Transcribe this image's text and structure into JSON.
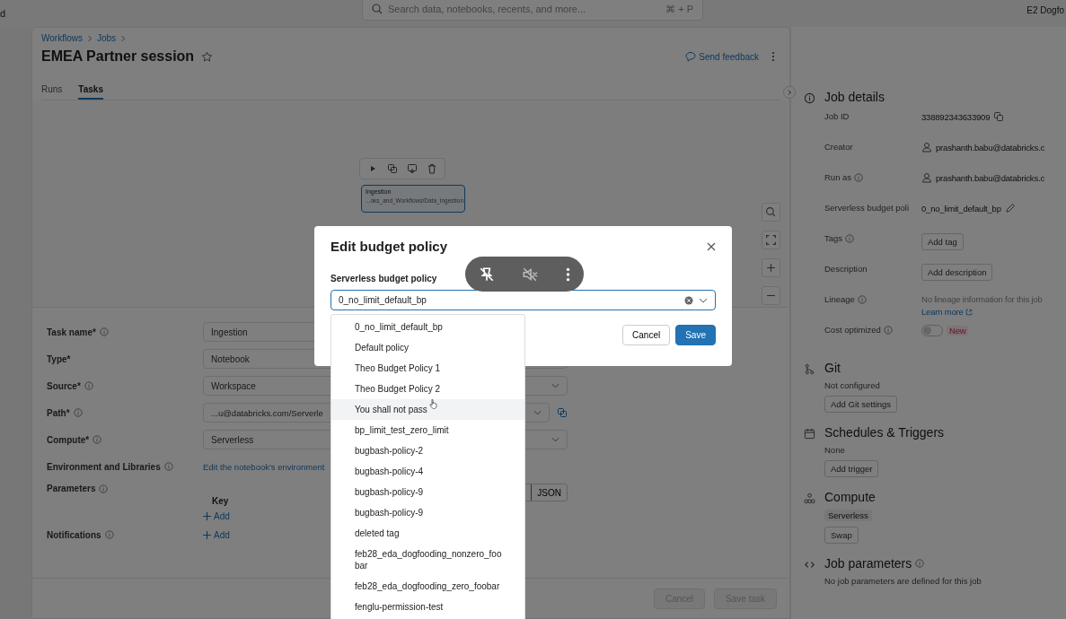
{
  "top_bar": {
    "left_text": "d",
    "search": {
      "placeholder": "Search data, notebooks, recents, and more...",
      "shortcut": "⌘ + P"
    },
    "workspace": "E2 Dogfo"
  },
  "breadcrumbs": [
    "Workflows",
    "Jobs"
  ],
  "job_title": "EMEA Partner session",
  "feedback": "Send feedback",
  "tabs": [
    {
      "label": "Runs",
      "selected": false
    },
    {
      "label": "Tasks",
      "selected": true
    }
  ],
  "task_node": {
    "name": "Ingestion",
    "path": "...oks_and_Workflows/Data_Ingestion"
  },
  "task_form": [
    {
      "kind": "input",
      "label": "Task name*",
      "info": true,
      "value": "Ingestion"
    },
    {
      "kind": "input",
      "label": "Type*",
      "info": false,
      "value": "Notebook"
    },
    {
      "kind": "select",
      "label": "Source*",
      "info": true,
      "value": "Workspace"
    },
    {
      "kind": "path",
      "label": "Path*",
      "info": true,
      "value": "...u@databricks.com/Serverle"
    },
    {
      "kind": "select",
      "label": "Compute*",
      "info": true,
      "value": "Serverless"
    },
    {
      "kind": "link",
      "label": "Environment and Libraries",
      "info": true,
      "value": "Edit the notebook's environment"
    },
    {
      "kind": "params",
      "label": "Parameters",
      "info": true,
      "key_header": "Key",
      "add": "Add",
      "toggle": "JSON"
    },
    {
      "kind": "add",
      "label": "Notifications",
      "info": true,
      "add": "Add"
    }
  ],
  "form_buttons": [
    {
      "label": "Cancel",
      "disabled": true
    },
    {
      "label": "Save task",
      "disabled": true
    }
  ],
  "job_details": {
    "title": "Job details",
    "fields": [
      {
        "kind": "copy",
        "label": "Job ID",
        "info": false,
        "value": "338892343633909"
      },
      {
        "kind": "user",
        "label": "Creator",
        "info": false,
        "value": "prashanth.babu@databricks.c"
      },
      {
        "kind": "user",
        "label": "Run as",
        "info": true,
        "value": "prashanth.babu@databricks.c"
      },
      {
        "kind": "edit",
        "label": "Serverless budget poli",
        "info": false,
        "value": "0_no_limit_default_bp"
      },
      {
        "kind": "button",
        "label": "Tags",
        "info": true,
        "value": "Add tag"
      },
      {
        "kind": "button",
        "label": "Description",
        "info": false,
        "value": "Add description"
      },
      {
        "kind": "lineage",
        "label": "Lineage",
        "info": true,
        "value": "No lineage information for this job",
        "link": "Learn more"
      },
      {
        "kind": "toggle",
        "label": "Cost optimized",
        "info": true,
        "on": false,
        "badge": "New"
      }
    ]
  },
  "sections": [
    {
      "kind": "git",
      "title": "Git",
      "info": false,
      "text": "Not configured",
      "button": "Add Git settings"
    },
    {
      "kind": "schedule",
      "title": "Schedules & Triggers",
      "info": false,
      "text": "None",
      "button": "Add trigger"
    },
    {
      "kind": "compute",
      "title": "Compute",
      "info": false,
      "tag": "Serverless",
      "button": "Swap"
    },
    {
      "kind": "params",
      "title": "Job parameters",
      "info": true,
      "text": "No job parameters are defined for this job"
    }
  ],
  "dialog": {
    "title": "Edit budget policy",
    "field_label": "Serverless budget policy",
    "value": "0_no_limit_default_bp",
    "buttons": [
      "Cancel",
      "Save"
    ]
  },
  "policy_options": [
    {
      "label": "0_no_limit_default_bp",
      "highlighted": false
    },
    {
      "label": "Default policy",
      "highlighted": false
    },
    {
      "label": "Theo Budget Policy 1",
      "highlighted": false
    },
    {
      "label": "Theo Budget Policy 2",
      "highlighted": false
    },
    {
      "label": "You shall not pass",
      "highlighted": true
    },
    {
      "label": "bp_limit_test_zero_limit",
      "highlighted": false
    },
    {
      "label": "bugbash-policy-2",
      "highlighted": false
    },
    {
      "label": "bugbash-policy-4",
      "highlighted": false
    },
    {
      "label": "bugbash-policy-9",
      "highlighted": false
    },
    {
      "label": "bugbash-policy-9",
      "highlighted": false
    },
    {
      "label": "deleted tag",
      "highlighted": false
    },
    {
      "label": "feb28_eda_dogfooding_nonzero_foobar",
      "highlighted": false
    },
    {
      "label": "feb28_eda_dogfooding_zero_foobar",
      "highlighted": false
    },
    {
      "label": "fenglu-permission-test",
      "highlighted": false
    }
  ]
}
